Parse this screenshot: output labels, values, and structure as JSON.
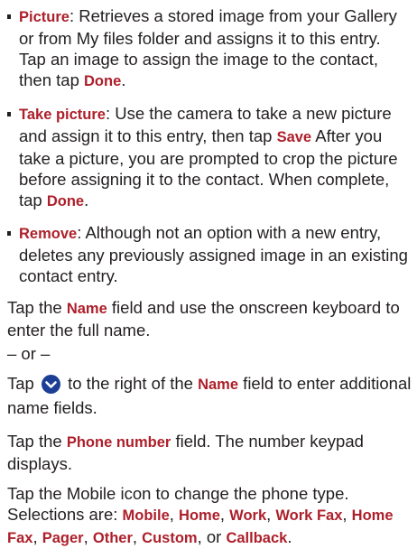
{
  "bullets": [
    {
      "term": "Picture",
      "text1": ": Retrieves a stored image from your Gallery or from My files folder and assigns it to this entry. Tap an image to assign the image to the contact, then tap ",
      "done": "Done",
      "text2": "."
    },
    {
      "term": "Take picture",
      "text1": ": Use the camera to take a new picture and assign it to this entry, then tap ",
      "save": "Save",
      "text2": " After you take a picture, you are prompted to crop the picture before assigning it to the contact. When complete, tap ",
      "done": "Done",
      "text3": "."
    },
    {
      "term": "Remove",
      "text1": ": Although not an option with a new entry, deletes any previously assigned image in an existing contact entry."
    }
  ],
  "para_name": {
    "pre": "Tap the ",
    "field": "Name",
    "post": " field and use the onscreen keyboard to enter the full name."
  },
  "or_text": "– or –",
  "para_expand": {
    "pre": "Tap ",
    "mid": " to the right of the ",
    "field": "Name",
    "post": " field to enter additional name fields."
  },
  "para_phone": {
    "pre": "Tap the ",
    "field": "Phone number",
    "post": " field. The number keypad displays."
  },
  "para_mobile": {
    "pre": "Tap the Mobile icon to change the phone type. Selections are: ",
    "options": [
      "Mobile",
      "Home",
      "Work",
      "Work Fax",
      "Home Fax",
      "Pager",
      "Other",
      "Custom",
      "Callback"
    ],
    "sep": ", ",
    "or": ", or ",
    "end": "."
  },
  "colors": {
    "text": "#231f20",
    "ui_term": "#ad1f2a",
    "chevron_circle": "#1c3f95"
  },
  "icons": {
    "expand": "chevron-down-circle-icon"
  }
}
